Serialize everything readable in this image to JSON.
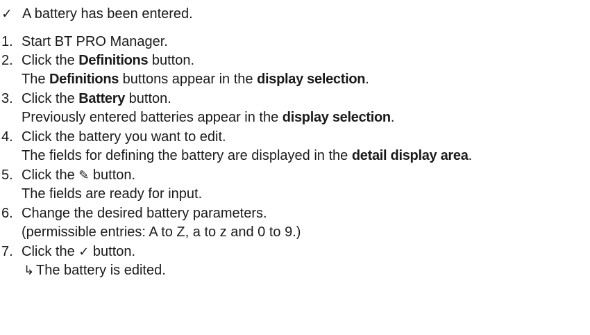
{
  "prerequisite": {
    "icon": "checkmark-icon",
    "mark": "✓",
    "text": "A battery has been entered."
  },
  "steps": [
    {
      "number": "1.",
      "action": "Start BT PRO Manager."
    },
    {
      "number": "2.",
      "action_pre": "Click the ",
      "action_bold": "Definitions",
      "action_post": " button.",
      "result_pre": "The ",
      "result_bold1": "Definitions",
      "result_mid": " buttons appear in the ",
      "result_bold2": "display selection",
      "result_post": "."
    },
    {
      "number": "3.",
      "action_pre": "Click the ",
      "action_bold": "Battery",
      "action_post": " button.",
      "result_pre": "Previously entered batteries appear in the ",
      "result_bold": "display selection",
      "result_post": "."
    },
    {
      "number": "4.",
      "action": "Click the battery you want to edit.",
      "result_pre": "The fields for defining the battery are displayed in the ",
      "result_bold": "detail display area",
      "result_post": "."
    },
    {
      "number": "5.",
      "action_pre": "Click the ",
      "action_icon": "pencil-icon",
      "action_icon_glyph": "✎",
      "action_post": " button.",
      "result": "The fields are ready for input."
    },
    {
      "number": "6.",
      "action": "Change the desired battery parameters.",
      "result": "(permissible entries: A to Z, a to z and 0 to 9.)"
    },
    {
      "number": "7.",
      "action_pre": "Click the ",
      "action_icon": "checkmark-icon",
      "action_icon_glyph": "✓",
      "action_post": " button.",
      "result_icon": "result-arrow-icon",
      "result_arrow": "↳",
      "result": "The battery is edited."
    }
  ]
}
